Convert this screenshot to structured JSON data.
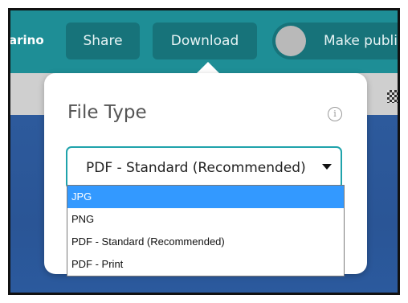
{
  "toolbar": {
    "brand_text": "arino",
    "share_label": "Share",
    "download_label": "Download",
    "make_public_label": "Make publi"
  },
  "popup": {
    "title": "File Type",
    "info_icon": "info-icon",
    "select": {
      "current_value": "PDF - Standard (Recommended)"
    }
  },
  "dropdown": {
    "options": [
      {
        "label": "JPG",
        "highlighted": true
      },
      {
        "label": "PNG",
        "highlighted": false
      },
      {
        "label": "PDF - Standard (Recommended)",
        "highlighted": false
      },
      {
        "label": "PDF - Print",
        "highlighted": false
      }
    ]
  },
  "colors": {
    "toolbar": "#1e8e96",
    "button": "#17737a",
    "select_border": "#1fa3ab",
    "highlight": "#3399ff"
  }
}
